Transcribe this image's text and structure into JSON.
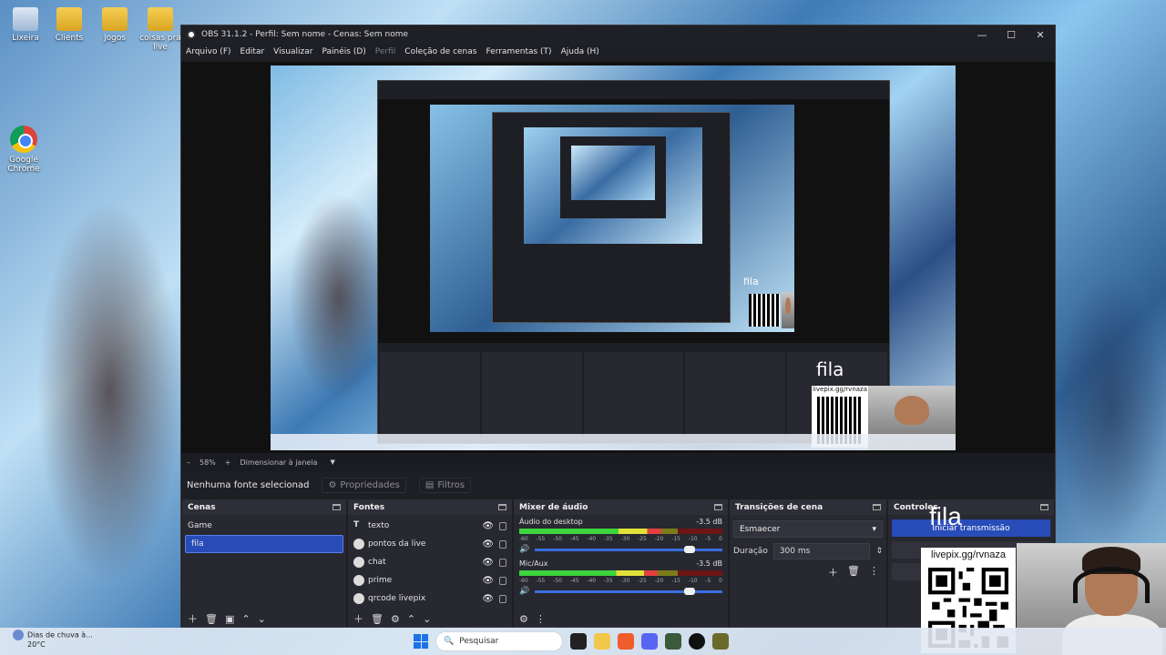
{
  "desktop": {
    "icons": [
      {
        "label": "Lixeira",
        "icon": "recycle-bin-icon"
      },
      {
        "label": "Clients",
        "icon": "folder-icon"
      },
      {
        "label": "Jogos",
        "icon": "folder-icon"
      },
      {
        "label": "coisas pra live",
        "icon": "folder-icon"
      },
      {
        "label": "Google Chrome",
        "icon": "chrome-icon"
      }
    ]
  },
  "window": {
    "title": "OBS 31.1.2 - Perfil: Sem nome - Cenas: Sem nome",
    "controls": {
      "minimize": "—",
      "maximize": "☐",
      "close": "✕"
    }
  },
  "menu": [
    {
      "label": "Arquivo (F)",
      "enabled": true
    },
    {
      "label": "Editar",
      "enabled": true
    },
    {
      "label": "Visualizar",
      "enabled": true
    },
    {
      "label": "Painéis (D)",
      "enabled": true
    },
    {
      "label": "Perfil",
      "enabled": false
    },
    {
      "label": "Coleção de cenas",
      "enabled": true
    },
    {
      "label": "Ferramentas (T)",
      "enabled": true
    },
    {
      "label": "Ajuda (H)",
      "enabled": true
    }
  ],
  "scale_bar": {
    "minus": "–",
    "zoom": "58%",
    "plus": "+",
    "fit": "Dimensionar à janela"
  },
  "context_bar": {
    "no_source": "Nenhuma fonte selecionad",
    "properties": "Propriedades",
    "filters": "Filtros"
  },
  "scenes": {
    "title": "Cenas",
    "items": [
      {
        "label": "Game",
        "selected": false
      },
      {
        "label": "fila",
        "selected": true
      }
    ]
  },
  "sources": {
    "title": "Fontes",
    "items": [
      {
        "label": "texto",
        "icon": "text-icon"
      },
      {
        "label": "pontos da live",
        "icon": "browser-icon"
      },
      {
        "label": "chat",
        "icon": "browser-icon"
      },
      {
        "label": "prime",
        "icon": "browser-icon"
      },
      {
        "label": "qrcode livepix",
        "icon": "browser-icon"
      }
    ]
  },
  "mixer": {
    "title": "Mixer de áudio",
    "channels": [
      {
        "name": "Áudio do desktop",
        "db": "-3.5 dB",
        "level": 0.7
      },
      {
        "name": "Mic/Aux",
        "db": "-3.5 dB",
        "level": 0.68
      }
    ],
    "ticks": [
      "-60",
      "-55",
      "-50",
      "-45",
      "-40",
      "-35",
      "-30",
      "-25",
      "-20",
      "-15",
      "-10",
      "-5",
      "0"
    ]
  },
  "transitions": {
    "title": "Transições de cena",
    "selected": "Esmaecer",
    "duration_label": "Duração",
    "duration_value": "300 ms"
  },
  "controls": {
    "title": "Controles",
    "start_stream": "Iniciar transmissão"
  },
  "overlay": {
    "queue_text": "fila",
    "pix_url": "livepix.gg/rvnaza"
  },
  "taskbar": {
    "weather_text": "Dias de chuva à...",
    "temperature": "20°C",
    "search_placeholder": "Pesquisar"
  },
  "colors": {
    "accent": "#284cb8",
    "dock_bg": "#272830",
    "window_bg": "#1e1f25"
  }
}
